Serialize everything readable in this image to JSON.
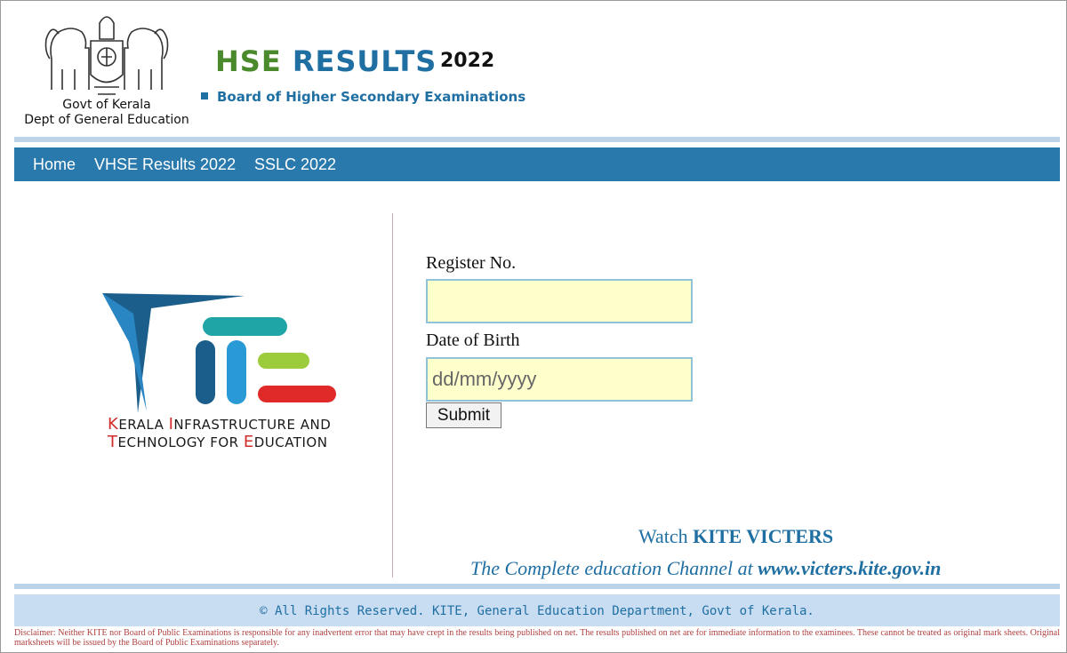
{
  "header": {
    "govt_line1": "Govt of Kerala",
    "govt_line2": "Dept of General Education",
    "title_part1": "HSE",
    "title_part2": "RESULTS",
    "year": "2022",
    "subtitle": "Board of Higher Secondary Examinations",
    "emblem_icon": "kerala-emblem-icon"
  },
  "nav": {
    "items": [
      {
        "label": "Home"
      },
      {
        "label": "VHSE Results 2022"
      },
      {
        "label": "SSLC 2022"
      }
    ]
  },
  "kite": {
    "logo_icon": "kite-logo-icon",
    "caption_line1_K": "K",
    "caption_line1_a": "ERALA ",
    "caption_line1_I": "I",
    "caption_line1_b": "NFRASTRUCTURE AND",
    "caption_line2_T": "T",
    "caption_line2_a": "ECHNOLOGY FOR ",
    "caption_line2_E": "E",
    "caption_line2_b": "DUCATION"
  },
  "form": {
    "register_label": "Register No.",
    "register_value": "",
    "dob_label": "Date of Birth",
    "dob_placeholder": "dd/mm/yyyy",
    "dob_value": "",
    "submit_label": "Submit"
  },
  "promo": {
    "watch_prefix": "Watch ",
    "watch_brand": "KITE VICTERS",
    "channel_prefix": "The Complete education Channel at ",
    "channel_url": "www.victers.kite.gov.in"
  },
  "footer": {
    "copyright": "© All Rights Reserved. KITE, General Education Department, Govt of Kerala.",
    "disclaimer": "Disclaimer: Neither KITE nor Board of Public Examinations is responsible for any inadvertent error that may have crept in the results being published on net. The results published on net are for immediate information to the examinees. These cannot be treated as original mark sheets. Original marksheets will be issued by the Board of Public Examinations separately."
  },
  "colors": {
    "nav_bg": "#2979ad",
    "brand_blue": "#1f6fa3",
    "brand_green": "#4a8a2c",
    "input_bg": "#ffffcc"
  }
}
